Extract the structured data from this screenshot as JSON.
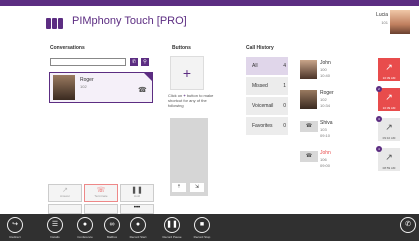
{
  "header": {
    "app_title": "PIMphony Touch [PRO]",
    "user_name": "Lucia",
    "user_ext": "101"
  },
  "conversations": {
    "title": "Conversations",
    "search_value": "",
    "contact": {
      "name": "Roger",
      "ext": "102"
    },
    "actions": [
      {
        "label": "Answer",
        "icon": "phone-icon"
      },
      {
        "label": "Terminate",
        "icon": "hangup-icon"
      },
      {
        "label": "Hold",
        "icon": "pause-icon"
      }
    ]
  },
  "buttons": {
    "title": "Buttons",
    "hint_parts": [
      "Click on",
      "button",
      "to make shortcut for",
      "any of the following"
    ]
  },
  "call_history": {
    "title": "Call History",
    "tabs": [
      {
        "label": "All",
        "count": "4"
      },
      {
        "label": "Missed",
        "count": "1"
      },
      {
        "label": "Voicemail",
        "count": "0"
      },
      {
        "label": "Favorites",
        "count": "0"
      }
    ],
    "calls": [
      {
        "name": "John",
        "ext": "100",
        "time": "10:40",
        "btn_time": "10:39 AM",
        "status": "missed",
        "badge": ""
      },
      {
        "name": "Roger",
        "ext": "102",
        "time": "10:34",
        "btn_time": "10:39 AM",
        "status": "missed",
        "badge": "2"
      },
      {
        "name": "Shiva",
        "ext": "103",
        "time": "09:10",
        "btn_time": "09:10 AM",
        "status": "normal",
        "badge": "3"
      },
      {
        "name": "John",
        "ext": "106",
        "time": "09:00",
        "btn_time": "08:59 AM",
        "status": "normal",
        "badge": "4"
      }
    ]
  },
  "toolbar": {
    "items": [
      {
        "label": "Redirect"
      },
      {
        "label": "Details"
      },
      {
        "label": "Conference"
      },
      {
        "label": "Mailbox"
      },
      {
        "label": "Record Start"
      },
      {
        "label": "Record Pause"
      },
      {
        "label": "Record Stop"
      }
    ]
  },
  "colors": {
    "brand": "#5c2d82",
    "missed": "#e84c4c",
    "toolbar_bg": "#303030"
  }
}
